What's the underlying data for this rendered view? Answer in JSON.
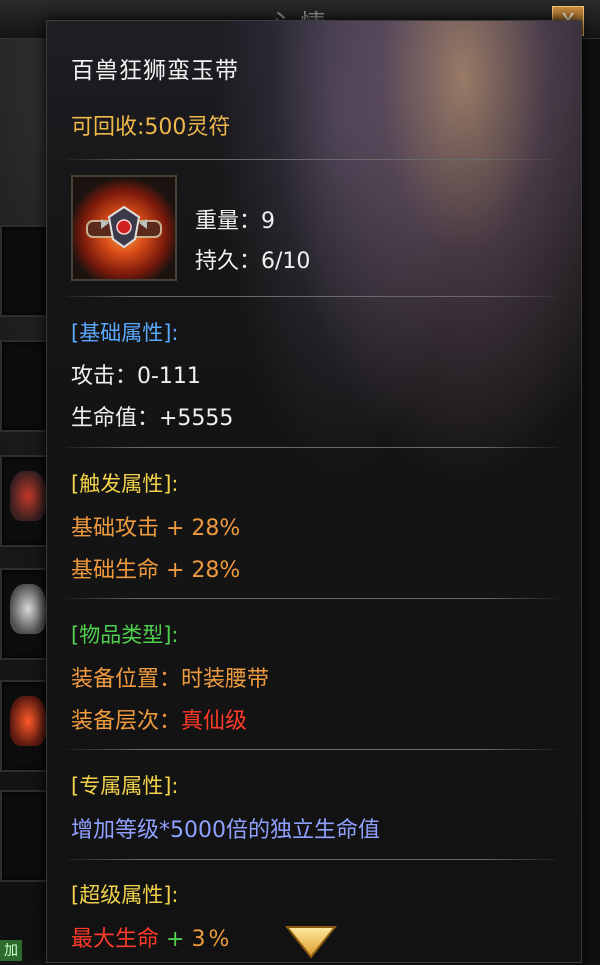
{
  "background_window": {
    "title": "心情",
    "close_label": "X",
    "bottom_tag": "加"
  },
  "tooltip": {
    "item_name": "百兽狂狮蛮玉带",
    "recycle_value": "可回收:500灵符",
    "item_icon": "belt-icon",
    "weight": "重量：9",
    "durability": "持久：6/10",
    "sections": {
      "base": {
        "header": "[基础属性]:",
        "lines": [
          "攻击：0-111",
          "生命值：+5555"
        ]
      },
      "trigger": {
        "header": "[触发属性]:",
        "lines": [
          "基础攻击 + 28%",
          "基础生命 + 28%"
        ]
      },
      "item_type": {
        "header": "[物品类型]:",
        "slot_label": "装备位置：",
        "slot_value": "时装腰带",
        "tier_label": "装备层次：",
        "tier_value": "真仙级"
      },
      "exclusive": {
        "header": "[专属属性]:",
        "lines": [
          "增加等级*5000倍的独立生命值"
        ]
      },
      "super": {
        "header": "[超级属性]:",
        "stat_name": "最大生命",
        "stat_plus": "+",
        "stat_value": "3%"
      }
    },
    "scroll_indicator": "chevron-down-icon"
  },
  "colors": {
    "item_name": "#f2f2f2",
    "recycle": "#f0b84a",
    "base_header": "#5aa9ff",
    "trigger": "#f1d24a",
    "trigger_lines": "#ef9a3f",
    "type_header": "#4fd04f",
    "tier_value": "#ff3a2a",
    "exclusive_line": "#8fa0ff",
    "super_stat": "#ff3a2a"
  }
}
